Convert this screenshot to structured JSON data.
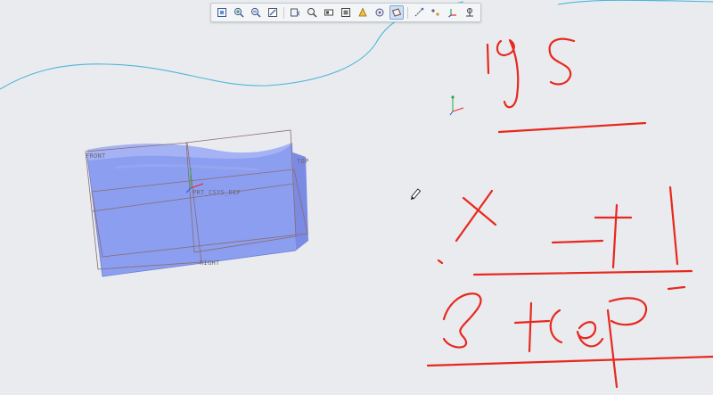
{
  "toolbar": {
    "buttons": [
      {
        "icon": "refit-icon"
      },
      {
        "icon": "zoom-in-icon"
      },
      {
        "icon": "zoom-out-icon"
      },
      {
        "icon": "repaint-icon"
      },
      {
        "icon": "saved-orientations-icon"
      },
      {
        "icon": "view-manager-icon"
      },
      {
        "icon": "display-style-icon"
      },
      {
        "icon": "shading-icon"
      },
      {
        "icon": "perspective-icon"
      },
      {
        "icon": "spin-center-icon"
      },
      {
        "icon": "datum-planes-icon"
      },
      {
        "icon": "datum-axes-icon"
      },
      {
        "icon": "datum-points-icon"
      },
      {
        "icon": "coordinate-systems-icon"
      },
      {
        "icon": "annotations-icon"
      }
    ]
  },
  "datums": {
    "front": "FRONT",
    "top": "TOP",
    "right": "RIGHT",
    "csys": "PRT_CSYS_DEF"
  },
  "colors": {
    "background": "#e9ebee",
    "curve": "#4fb6d8",
    "part_fill": "#8b9ef0",
    "part_edge": "#6f7fd2",
    "datum_plane": "#8b6b70",
    "sketch": "#e8281e"
  }
}
